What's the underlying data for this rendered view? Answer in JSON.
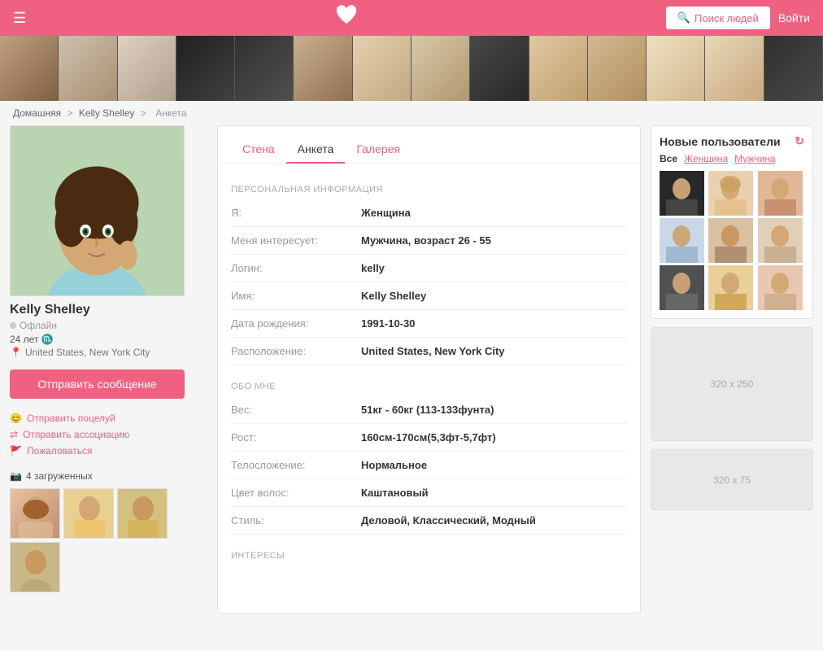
{
  "header": {
    "search_label": "Поиск людей",
    "login_label": "Войти",
    "heart": "♥"
  },
  "breadcrumb": {
    "home": "Домашняя",
    "sep1": ">",
    "user": "Kelly Shelley",
    "sep2": ">",
    "page": "Анкета"
  },
  "profile": {
    "name": "Kelly Shelley",
    "status": "Офлайн",
    "age_sign": "24 лет ♏",
    "location": "United States, New York City",
    "send_message": "Отправить сообщение",
    "send_kiss": "Отправить поцелуй",
    "send_association": "Отправить ассоциацию",
    "complain": "Пожаловаться",
    "photos_count": "4 загруженных"
  },
  "tabs": {
    "wall": "Стена",
    "profile": "Анкета",
    "gallery": "Галерея"
  },
  "personal": {
    "section_title": "ПЕРСОНАЛЬНАЯ ИНФОРМАЦИЯ",
    "gender_label": "Я:",
    "gender_value": "Женщина",
    "interest_label": "Меня интересует:",
    "interest_value": "Мужчина, возраст 26 - 55",
    "login_label": "Логин:",
    "login_value": "kelly",
    "name_label": "Имя:",
    "name_value": "Kelly Shelley",
    "birthday_label": "Дата рождения:",
    "birthday_value": "1991-10-30",
    "location_label": "Расположение:",
    "location_value": "United States, New York City"
  },
  "about": {
    "section_title": "ОБО МНЕ",
    "weight_label": "Вес:",
    "weight_value": "51кг - 60кг (113-133фунта)",
    "height_label": "Рост:",
    "height_value": "160см-170см(5,3фт-5,7фт)",
    "build_label": "Телосложение:",
    "build_value": "Нормальное",
    "hair_label": "Цвет волос:",
    "hair_value": "Каштановый",
    "style_label": "Стиль:",
    "style_value": "Деловой, Классический, Модный"
  },
  "interests": {
    "section_title": "ИНТЕРЕСЫ"
  },
  "new_users": {
    "title": "Новые пользователи",
    "all": "Все",
    "female": "Женщина",
    "male": "Мужчина"
  },
  "ads": {
    "large": "320 x 250",
    "small": "320 x 75"
  }
}
